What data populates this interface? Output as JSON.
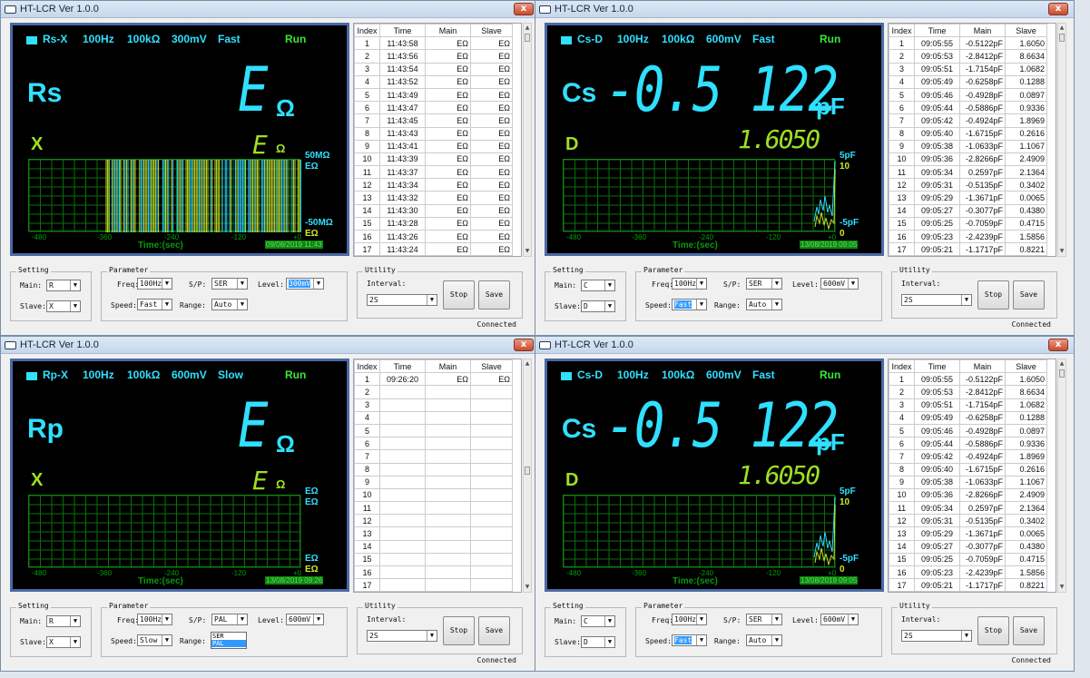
{
  "app_title": "HT-LCR Ver 1.0.0",
  "close_glyph": "x",
  "table_headers": [
    "Index",
    "Time",
    "Main",
    "Slave"
  ],
  "x_ticks": [
    "-480",
    "-360",
    "-240",
    "-120",
    "+0"
  ],
  "time_label": "Time:(sec)",
  "labels": {
    "setting": "Setting",
    "main": "Main:",
    "slave": "Slave:",
    "parameter": "Parameter",
    "freq": "Freq:",
    "sp": "S/P:",
    "level": "Level:",
    "speed": "Speed:",
    "range": "Range:",
    "utility": "Utility",
    "interval": "Interval:",
    "stop": "Stop",
    "save": "Save",
    "connected": "Connected"
  },
  "windows": [
    {
      "header": {
        "mode": "Rs-X",
        "freq": "100Hz",
        "range": "100kΩ",
        "level": "300mV",
        "speed": "Fast",
        "status": "Run"
      },
      "primary": {
        "param": "Rs",
        "value": "E",
        "unit": "Ω"
      },
      "secondary": {
        "param": "X",
        "value": "E",
        "unit": "Ω"
      },
      "y_top": [
        "50MΩ",
        "EΩ"
      ],
      "y_bot": [
        "-50MΩ",
        "EΩ"
      ],
      "date": "09/08/2019 11:43",
      "rows": [
        [
          "1",
          "11:43:58",
          "EΩ",
          "EΩ"
        ],
        [
          "2",
          "11:43:56",
          "EΩ",
          "EΩ"
        ],
        [
          "3",
          "11:43:54",
          "EΩ",
          "EΩ"
        ],
        [
          "4",
          "11:43:52",
          "EΩ",
          "EΩ"
        ],
        [
          "5",
          "11:43:49",
          "EΩ",
          "EΩ"
        ],
        [
          "6",
          "11:43:47",
          "EΩ",
          "EΩ"
        ],
        [
          "7",
          "11:43:45",
          "EΩ",
          "EΩ"
        ],
        [
          "8",
          "11:43:43",
          "EΩ",
          "EΩ"
        ],
        [
          "9",
          "11:43:41",
          "EΩ",
          "EΩ"
        ],
        [
          "10",
          "11:43:39",
          "EΩ",
          "EΩ"
        ],
        [
          "11",
          "11:43:37",
          "EΩ",
          "EΩ"
        ],
        [
          "12",
          "11:43:34",
          "EΩ",
          "EΩ"
        ],
        [
          "13",
          "11:43:32",
          "EΩ",
          "EΩ"
        ],
        [
          "14",
          "11:43:30",
          "EΩ",
          "EΩ"
        ],
        [
          "15",
          "11:43:28",
          "EΩ",
          "EΩ"
        ],
        [
          "16",
          "11:43:26",
          "EΩ",
          "EΩ"
        ],
        [
          "17",
          "11:43:24",
          "EΩ",
          "EΩ"
        ]
      ],
      "setting": {
        "main": "R",
        "slave": "X"
      },
      "parameter": {
        "freq": "100Hz",
        "sp": "SER",
        "level": "300mV",
        "speed": "Fast",
        "range": "Auto"
      },
      "utility": {
        "interval": "2S"
      },
      "level_highlight": true,
      "speed_highlight": false,
      "sp_open": false
    },
    {
      "header": {
        "mode": "Cs-D",
        "freq": "100Hz",
        "range": "100kΩ",
        "level": "600mV",
        "speed": "Fast",
        "status": "Run"
      },
      "primary": {
        "param": "Cs",
        "value": "-0.5 122",
        "unit": "pF"
      },
      "secondary": {
        "param": "D",
        "value": "1.6050",
        "unit": ""
      },
      "y_top": [
        "5pF",
        "10"
      ],
      "y_bot": [
        "-5pF",
        "0"
      ],
      "date": "13/08/2019 09:05",
      "rows": [
        [
          "1",
          "09:05:55",
          "-0.5122pF",
          "1.6050"
        ],
        [
          "2",
          "09:05:53",
          "-2.8412pF",
          "8.6634"
        ],
        [
          "3",
          "09:05:51",
          "-1.7154pF",
          "1.0682"
        ],
        [
          "4",
          "09:05:49",
          "-0.6258pF",
          "0.1288"
        ],
        [
          "5",
          "09:05:46",
          "-0.4928pF",
          "0.0897"
        ],
        [
          "6",
          "09:05:44",
          "-0.5886pF",
          "0.9336"
        ],
        [
          "7",
          "09:05:42",
          "-0.4924pF",
          "1.8969"
        ],
        [
          "8",
          "09:05:40",
          "-1.6715pF",
          "0.2616"
        ],
        [
          "9",
          "09:05:38",
          "-1.0633pF",
          "1.1067"
        ],
        [
          "10",
          "09:05:36",
          "-2.8266pF",
          "2.4909"
        ],
        [
          "11",
          "09:05:34",
          "0.2597pF",
          "2.1364"
        ],
        [
          "12",
          "09:05:31",
          "-0.5135pF",
          "0.3402"
        ],
        [
          "13",
          "09:05:29",
          "-1.3671pF",
          "0.0065"
        ],
        [
          "14",
          "09:05:27",
          "-0.3077pF",
          "0.4380"
        ],
        [
          "15",
          "09:05:25",
          "-0.7059pF",
          "0.4715"
        ],
        [
          "16",
          "09:05:23",
          "-2.4239pF",
          "1.5856"
        ],
        [
          "17",
          "09:05:21",
          "-1.1717pF",
          "0.8221"
        ]
      ],
      "setting": {
        "main": "C",
        "slave": "D"
      },
      "parameter": {
        "freq": "100Hz",
        "sp": "SER",
        "level": "600mV",
        "speed": "Fast",
        "range": "Auto"
      },
      "utility": {
        "interval": "2S"
      },
      "level_highlight": false,
      "speed_highlight": true,
      "sp_open": false
    },
    {
      "header": {
        "mode": "Rp-X",
        "freq": "100Hz",
        "range": "100kΩ",
        "level": "600mV",
        "speed": "Slow",
        "status": "Run"
      },
      "primary": {
        "param": "Rp",
        "value": "E",
        "unit": "Ω"
      },
      "secondary": {
        "param": "X",
        "value": "E",
        "unit": "Ω"
      },
      "y_top": [
        "EΩ",
        "EΩ"
      ],
      "y_bot": [
        "EΩ",
        "EΩ"
      ],
      "date": "13/08/2019 09:26",
      "rows": [
        [
          "1",
          "09:26:20",
          "EΩ",
          "EΩ"
        ],
        [
          "2",
          "",
          "",
          ""
        ],
        [
          "3",
          "",
          "",
          ""
        ],
        [
          "4",
          "",
          "",
          ""
        ],
        [
          "5",
          "",
          "",
          ""
        ],
        [
          "6",
          "",
          "",
          ""
        ],
        [
          "7",
          "",
          "",
          ""
        ],
        [
          "8",
          "",
          "",
          ""
        ],
        [
          "9",
          "",
          "",
          ""
        ],
        [
          "10",
          "",
          "",
          ""
        ],
        [
          "11",
          "",
          "",
          ""
        ],
        [
          "12",
          "",
          "",
          ""
        ],
        [
          "13",
          "",
          "",
          ""
        ],
        [
          "14",
          "",
          "",
          ""
        ],
        [
          "15",
          "",
          "",
          ""
        ],
        [
          "16",
          "",
          "",
          ""
        ],
        [
          "17",
          "",
          "",
          ""
        ]
      ],
      "setting": {
        "main": "R",
        "slave": "X"
      },
      "parameter": {
        "freq": "100Hz",
        "sp": "PAL",
        "level": "600mV",
        "speed": "Slow",
        "range": ""
      },
      "utility": {
        "interval": "2S"
      },
      "level_highlight": false,
      "speed_highlight": false,
      "sp_open": true,
      "sp_options": [
        "SER",
        "PAL"
      ]
    },
    {
      "header": {
        "mode": "Cs-D",
        "freq": "100Hz",
        "range": "100kΩ",
        "level": "600mV",
        "speed": "Fast",
        "status": "Run"
      },
      "primary": {
        "param": "Cs",
        "value": "-0.5 122",
        "unit": "pF"
      },
      "secondary": {
        "param": "D",
        "value": "1.6050",
        "unit": ""
      },
      "y_top": [
        "5pF",
        "10"
      ],
      "y_bot": [
        "-5pF",
        "0"
      ],
      "date": "13/08/2019 09:05",
      "rows": [
        [
          "1",
          "09:05:55",
          "-0.5122pF",
          "1.6050"
        ],
        [
          "2",
          "09:05:53",
          "-2.8412pF",
          "8.6634"
        ],
        [
          "3",
          "09:05:51",
          "-1.7154pF",
          "1.0682"
        ],
        [
          "4",
          "09:05:49",
          "-0.6258pF",
          "0.1288"
        ],
        [
          "5",
          "09:05:46",
          "-0.4928pF",
          "0.0897"
        ],
        [
          "6",
          "09:05:44",
          "-0.5886pF",
          "0.9336"
        ],
        [
          "7",
          "09:05:42",
          "-0.4924pF",
          "1.8969"
        ],
        [
          "8",
          "09:05:40",
          "-1.6715pF",
          "0.2616"
        ],
        [
          "9",
          "09:05:38",
          "-1.0633pF",
          "1.1067"
        ],
        [
          "10",
          "09:05:36",
          "-2.8266pF",
          "2.4909"
        ],
        [
          "11",
          "09:05:34",
          "0.2597pF",
          "2.1364"
        ],
        [
          "12",
          "09:05:31",
          "-0.5135pF",
          "0.3402"
        ],
        [
          "13",
          "09:05:29",
          "-1.3671pF",
          "0.0065"
        ],
        [
          "14",
          "09:05:27",
          "-0.3077pF",
          "0.4380"
        ],
        [
          "15",
          "09:05:25",
          "-0.7059pF",
          "0.4715"
        ],
        [
          "16",
          "09:05:23",
          "-2.4239pF",
          "1.5856"
        ],
        [
          "17",
          "09:05:21",
          "-1.1717pF",
          "0.8221"
        ]
      ],
      "setting": {
        "main": "C",
        "slave": "D"
      },
      "parameter": {
        "freq": "100Hz",
        "sp": "SER",
        "level": "600mV",
        "speed": "Fast",
        "range": "Auto"
      },
      "utility": {
        "interval": "2S"
      },
      "level_highlight": false,
      "speed_highlight": true,
      "sp_open": false
    }
  ]
}
